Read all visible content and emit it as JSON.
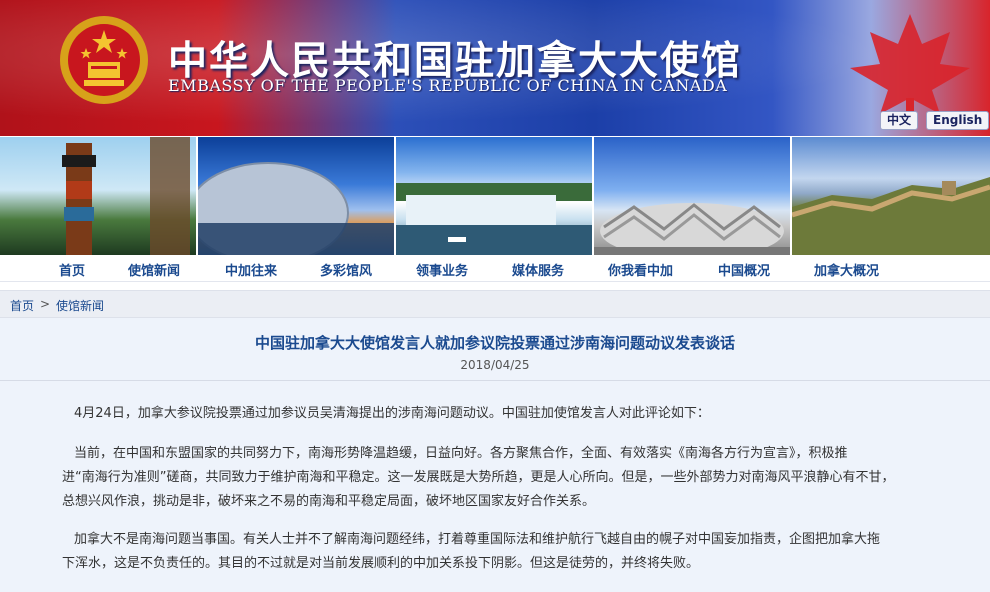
{
  "header": {
    "title_cn": "中华人民共和国驻加拿大大使馆",
    "title_en": "EMBASSY OF THE PEOPLE'S REPUBLIC OF CHINA IN CANADA",
    "lang_cn": "中文",
    "lang_en": "English"
  },
  "nav": [
    {
      "label": "首页"
    },
    {
      "label": "使馆新闻"
    },
    {
      "label": "中加往来"
    },
    {
      "label": "多彩馆风"
    },
    {
      "label": "领事业务"
    },
    {
      "label": "媒体服务"
    },
    {
      "label": "你我看中加"
    },
    {
      "label": "中国概况"
    },
    {
      "label": "加拿大概况"
    }
  ],
  "breadcrumb": {
    "home": "首页",
    "sep": ">",
    "current": "使馆新闻"
  },
  "article": {
    "headline": "中国驻加拿大大使馆发言人就加参议院投票通过涉南海问题动议发表谈话",
    "date": "2018/04/25",
    "p1": "4月24日，加拿大参议院投票通过加参议员吴清海提出的涉南海问题动议。中国驻加使馆发言人对此评论如下：",
    "p2_l1": "当前，在中国和东盟国家的共同努力下，南海形势降温趋缓，日益向好。各方聚焦合作，全面、有效落实《南海各方行为宣言》，积极推",
    "p2_l2": "进“南海行为准则”磋商，共同致力于维护南海和平稳定。这一发展既是大势所趋，更是人心所向。但是，一些外部势力对南海风平浪静心有不甘，",
    "p2_l3": "总想兴风作浪，挑动是非，破坏来之不易的南海和平稳定局面，破坏地区国家友好合作关系。",
    "p3_l1": "加拿大不是南海问题当事国。有关人士并不了解南海问题经纬，打着尊重国际法和维护航行飞越自由的幌子对中国妄加指责，企图把加拿大拖",
    "p3_l2": "下浑水，这是不负责任的。其目的不过就是对当前发展顺利的中加关系投下阴影。但这是徒劳的，并终将失败。"
  },
  "colors": {
    "nav_text": "#1b4a8f",
    "article_bg": "#eef3fb",
    "banner_red": "#c8161e",
    "banner_blue": "#1c3fa8"
  }
}
